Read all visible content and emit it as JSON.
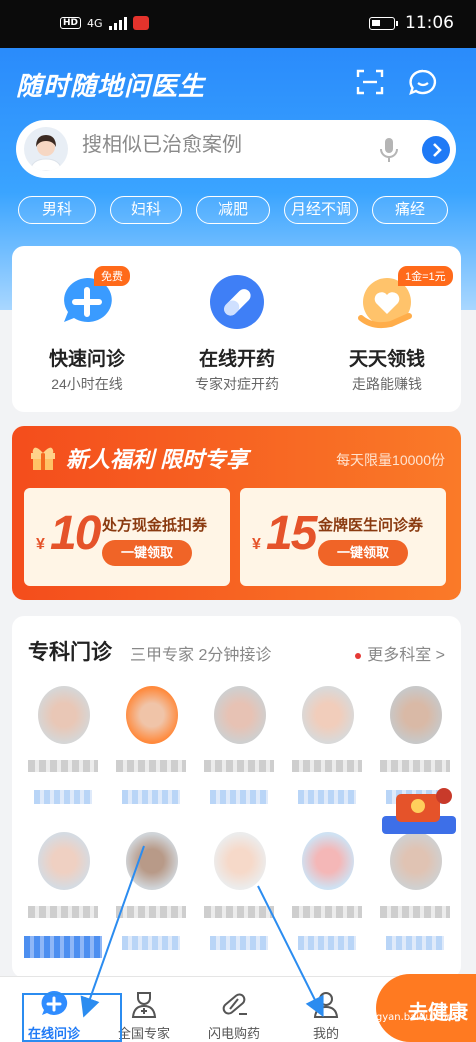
{
  "status_bar": {
    "hd": "HD",
    "network": "4G",
    "time": "11:06"
  },
  "header": {
    "title": "随时随地问医生"
  },
  "search": {
    "placeholder": "搜相似已治愈案例"
  },
  "tags": [
    "男科",
    "妇科",
    "减肥",
    "月经不调",
    "痛经"
  ],
  "services": [
    {
      "title": "快速问诊",
      "subtitle": "24小时在线",
      "badge": "免费",
      "icon": "chat-plus-icon"
    },
    {
      "title": "在线开药",
      "subtitle": "专家对症开药",
      "badge": "",
      "icon": "pill-icon"
    },
    {
      "title": "天天领钱",
      "subtitle": "走路能赚钱",
      "badge": "1金=1元",
      "icon": "coin-heart-icon"
    }
  ],
  "promo": {
    "title": "新人福利  限时专享",
    "subtitle": "每天限量10000份",
    "coupons": [
      {
        "currency": "¥",
        "amount": "10",
        "name": "处方现金抵扣券",
        "button": "一键领取"
      },
      {
        "currency": "¥",
        "amount": "15",
        "name": "金牌医生问诊券",
        "button": "一键领取"
      }
    ]
  },
  "departments": {
    "title": "专科门诊",
    "subtitle": "三甲专家 2分钟接诊",
    "more": "更多科室 >"
  },
  "tabbar": [
    {
      "label": "在线问诊",
      "icon": "consult-icon",
      "active": true
    },
    {
      "label": "全国专家",
      "icon": "doctor-icon",
      "active": false
    },
    {
      "label": "闪电购药",
      "icon": "pill-capsule-icon",
      "active": false
    },
    {
      "label": "我的",
      "icon": "user-icon",
      "active": false
    }
  ],
  "fab": {
    "label": "去健康"
  },
  "watermark": "jingyan.baidu.com",
  "colors": {
    "primary": "#1f7af6",
    "accent": "#ff7a21",
    "promo": "#f44d1c"
  }
}
